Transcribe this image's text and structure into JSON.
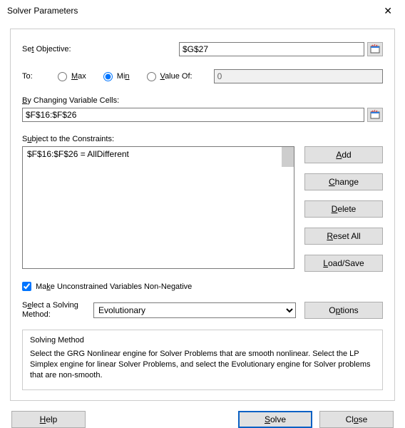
{
  "window": {
    "title": "Solver Parameters"
  },
  "objective": {
    "label_pre": "Se",
    "label_u": "t",
    "label_post": " Objective:",
    "value": "$G$27"
  },
  "to": {
    "label": "To:",
    "max_u": "M",
    "max_post": "ax",
    "min_post": "Mi",
    "min_u": "n",
    "valueof_u": "V",
    "valueof_post": "alue Of:",
    "value": "0",
    "selected": "min"
  },
  "changing": {
    "label_u": "B",
    "label_post": "y Changing Variable Cells:",
    "value": "$F$16:$F$26"
  },
  "constraints": {
    "label_pre": "S",
    "label_u": "u",
    "label_post": "bject to the Constraints:",
    "items": [
      "$F$16:$F$26 = AllDifferent"
    ]
  },
  "buttons": {
    "add_u": "A",
    "add_post": "dd",
    "change_u": "C",
    "change_post": "hange",
    "delete_u": "D",
    "delete_post": "elete",
    "reset_u": "R",
    "reset_post": "eset All",
    "load_u": "L",
    "load_post": "oad/Save",
    "options_pre": "O",
    "options_u": "p",
    "options_post": "tions",
    "help_u": "H",
    "help_post": "elp",
    "solve_u": "S",
    "solve_post": "olve",
    "close_pre": "Cl",
    "close_u": "o",
    "close_post": "se"
  },
  "checkbox": {
    "pre": "Ma",
    "u": "k",
    "post": "e Unconstrained Variables Non-Negative",
    "checked": true
  },
  "method": {
    "label_pre": "S",
    "label_u": "e",
    "label_post": "lect a Solving",
    "label_line2": "Method:",
    "selected": "Evolutionary"
  },
  "help": {
    "heading": "Solving Method",
    "body": "Select the GRG Nonlinear engine for Solver Problems that are smooth nonlinear. Select the LP Simplex engine for linear Solver Problems, and select the Evolutionary engine for Solver problems that are non-smooth."
  }
}
